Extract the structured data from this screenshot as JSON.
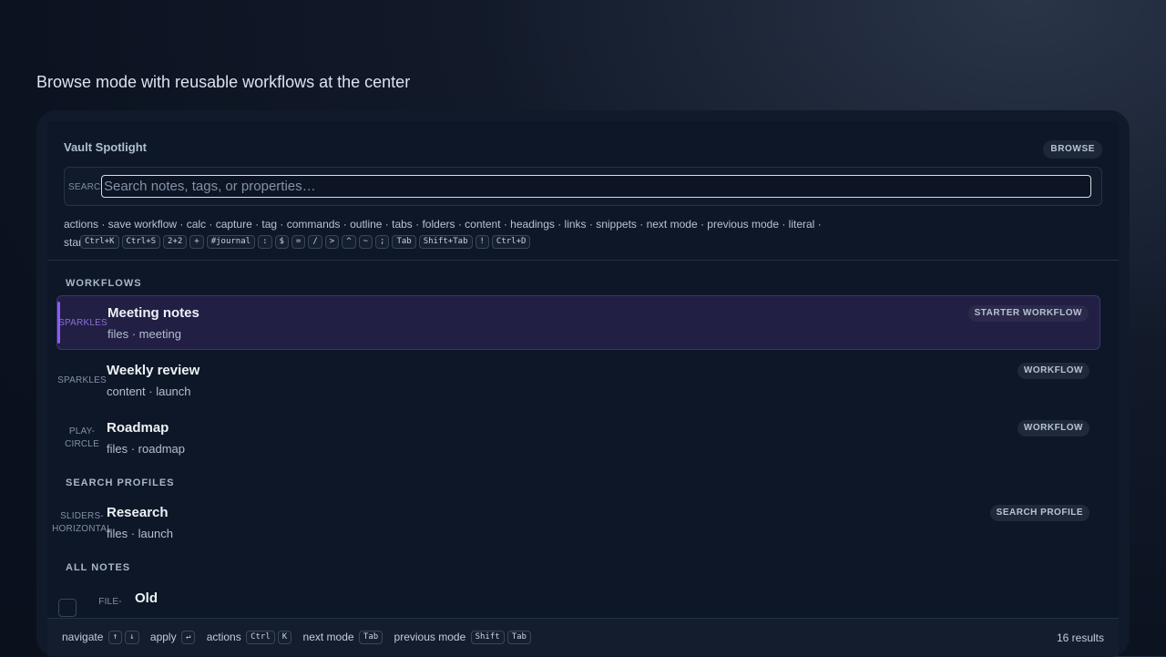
{
  "page_heading": "Browse mode with reusable workflows at the center",
  "panel": {
    "title": "Vault Spotlight",
    "mode_badge": "BROWSE"
  },
  "search": {
    "label": "SEARCH",
    "placeholder": "Search notes, tags, or properties…",
    "value": ""
  },
  "hints": {
    "line1": "actions · save workflow · calc · capture · tag · commands · outline · tabs · folders · content · headings · links · snippets · next mode · previous mode · literal ·",
    "line2_prefix": "start",
    "keys": [
      "Ctrl+K",
      "Ctrl+S",
      "2+2",
      "+",
      "#journal",
      ":",
      "$",
      "=",
      "/",
      ">",
      "^",
      "~",
      ";",
      "Tab",
      "Shift+Tab",
      "!",
      "Ctrl+D"
    ]
  },
  "sections": {
    "workflows": "WORKFLOWS",
    "search_profiles": "SEARCH PROFILES",
    "all_notes": "ALL NOTES"
  },
  "results": {
    "meeting_notes": {
      "icon": "SPARKLES",
      "title": "Meeting notes",
      "meta": "files · meeting",
      "badge": "STARTER WORKFLOW"
    },
    "weekly_review": {
      "icon": "SPARKLES",
      "title": "Weekly review",
      "meta": "content · launch",
      "badge": "WORKFLOW"
    },
    "roadmap": {
      "icon_line1": "PLAY-",
      "icon_line2": "CIRCLE",
      "title": "Roadmap",
      "meta": "files · roadmap",
      "badge": "WORKFLOW"
    },
    "research": {
      "icon_line1": "SLIDERS-",
      "icon_line2": "HORIZONTAL",
      "title": "Research",
      "meta": "files · launch",
      "badge": "SEARCH PROFILE"
    },
    "old": {
      "icon": "FILE-",
      "title": "Old"
    }
  },
  "footer": {
    "navigate": "navigate",
    "navigate_keys": [
      "↑",
      "↓"
    ],
    "apply": "apply",
    "apply_key": "↵",
    "actions": "actions",
    "actions_keys": [
      "Ctrl",
      "K"
    ],
    "next_mode": "next mode",
    "next_mode_key": "Tab",
    "previous_mode": "previous mode",
    "previous_mode_keys": [
      "Shift",
      "Tab"
    ],
    "count": "16 results"
  }
}
